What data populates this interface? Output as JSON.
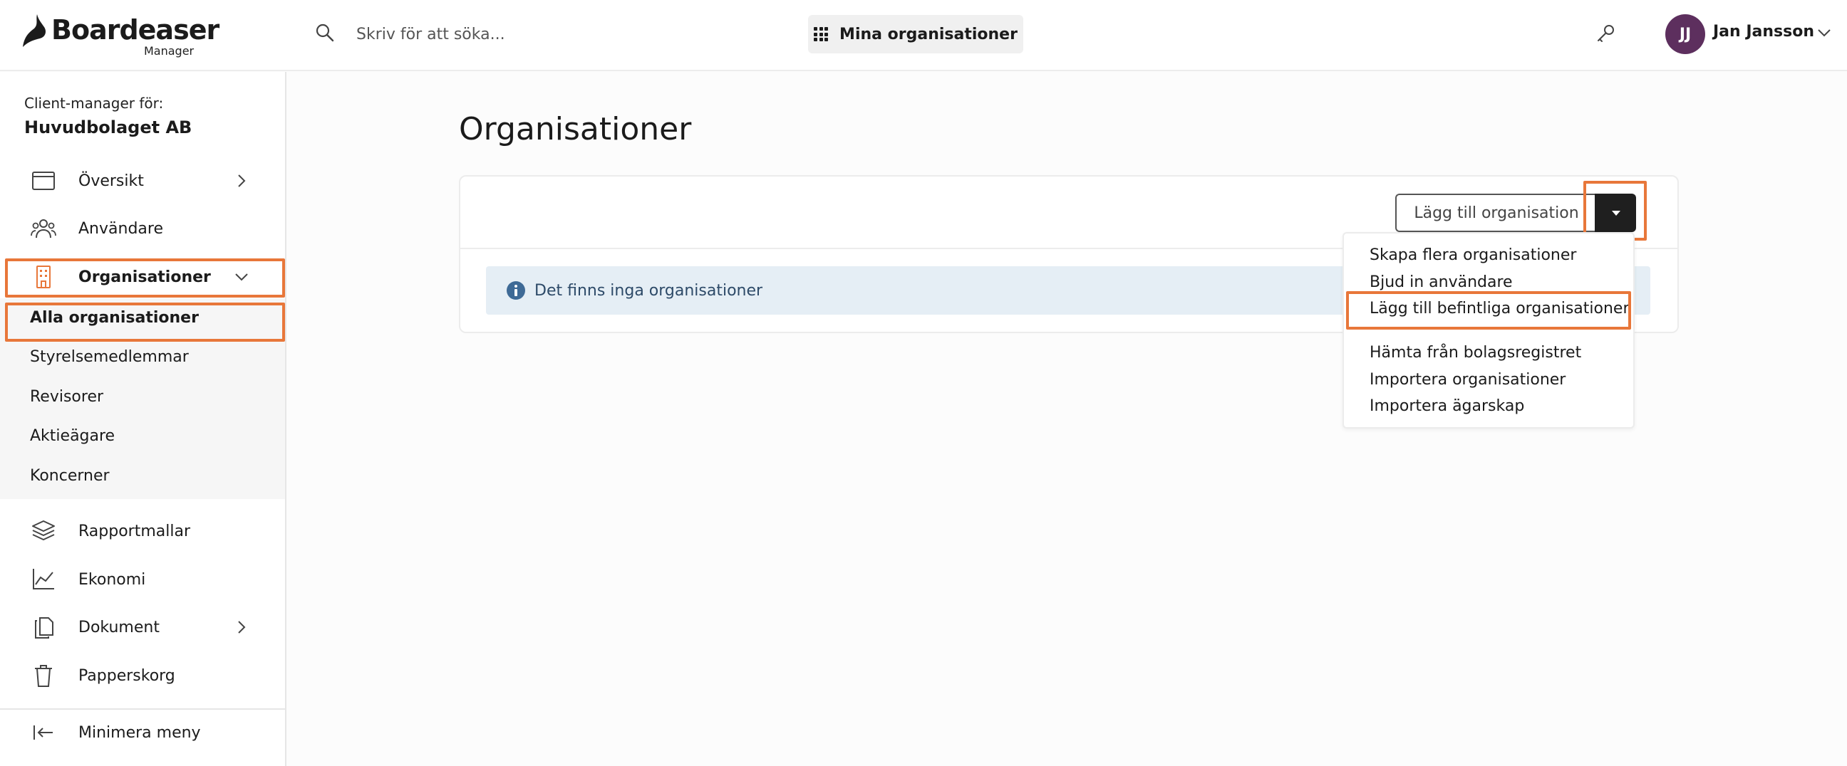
{
  "header": {
    "logo_name": "Boardeaser",
    "logo_sub": "Manager",
    "search_placeholder": "Skriv för att söka...",
    "my_orgs_label": "Mina organisationer",
    "avatar_initials": "JJ",
    "user_name": "Jan Jansson",
    "avatar_color": "#5d2f5e"
  },
  "sidebar": {
    "client_label": "Client-manager för:",
    "client_name": "Huvudbolaget AB",
    "items": [
      {
        "label": "Översikt",
        "icon": "browser-window-icon",
        "chevron": "right"
      },
      {
        "label": "Användare",
        "icon": "users-icon"
      },
      {
        "label": "Organisationer",
        "icon": "building-icon",
        "chevron": "down",
        "active": true
      },
      {
        "label": "Rapportmallar",
        "icon": "layers-icon"
      },
      {
        "label": "Ekonomi",
        "icon": "line-chart-icon"
      },
      {
        "label": "Dokument",
        "icon": "documents-icon",
        "chevron": "right"
      },
      {
        "label": "Papperskorg",
        "icon": "trash-icon"
      }
    ],
    "subitems": [
      {
        "label": "Alla organisationer",
        "active": true
      },
      {
        "label": "Styrelsemedlemmar"
      },
      {
        "label": "Revisorer"
      },
      {
        "label": "Aktieägare"
      },
      {
        "label": "Koncerner"
      }
    ],
    "minimize_label": "Minimera meny"
  },
  "main": {
    "title": "Organisationer",
    "add_button_label": "Lägg till organisation",
    "empty_message": "Det finns inga organisationer",
    "dropdown_items": [
      "Skapa flera organisationer",
      "Bjud in användare",
      "Lägg till befintliga organisationer",
      "Hämta från bolagsregistret",
      "Importera organisationer",
      "Importera ägarskap"
    ]
  },
  "colors": {
    "highlight": "#e8773a",
    "accent_orange": "#e8773a",
    "info_background": "#e5eef5",
    "info_icon": "#3e6a96",
    "dark_button": "#1f1f1f"
  }
}
